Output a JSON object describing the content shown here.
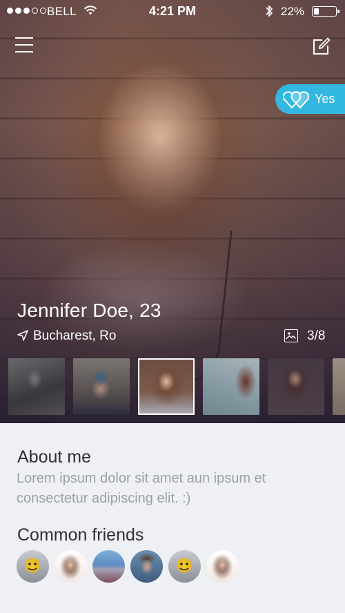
{
  "status_bar": {
    "carrier": "BELL",
    "time": "4:21 PM",
    "battery_pct": "22%",
    "battery_level": 0.22,
    "signal_bars_filled": 3,
    "signal_bars_total": 5
  },
  "nav": {
    "menu_icon": "hamburger-menu-icon",
    "edit_icon": "edit-compose-icon"
  },
  "match_badge": {
    "label": "Yes",
    "icon": "hearts-icon",
    "color": "#33b8e0"
  },
  "profile": {
    "name": "Jennifer Doe, 23",
    "location": "Bucharest, Ro",
    "photo_count": "3/8",
    "active_photo": 3
  },
  "about": {
    "title": "About me",
    "text": "Lorem ipsum dolor sit amet aun ipsum et consectetur adipiscing elit. :)"
  },
  "common_friends": {
    "title": "Common friends",
    "count": 6
  }
}
